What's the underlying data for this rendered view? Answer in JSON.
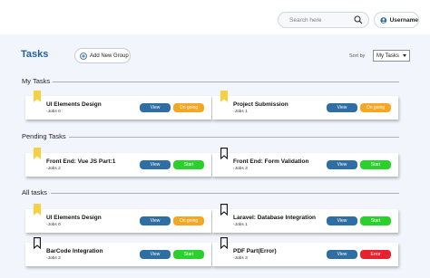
{
  "header": {
    "search_placeholder": "Search here",
    "username": "Username"
  },
  "toolbar": {
    "page_title": "Tasks",
    "add_group_label": "Add New Group",
    "sort_label": "Sort by",
    "sort_value": "My Tasks"
  },
  "colors": {
    "accent": "#1f5fa8",
    "view_button": "#2e6ea3",
    "ongoing": "#f5a623",
    "start": "#2bd12b",
    "error": "#e8212f",
    "bookmark_filled": "#f5d142"
  },
  "sections": [
    {
      "label": "My Tasks"
    },
    {
      "label": "Pending Tasks"
    },
    {
      "label": "All tasks"
    }
  ],
  "cards": [
    {
      "title": "UI Elements Design",
      "jobs": "-Jobs 0",
      "view": "View",
      "status": "On going",
      "bookmark": "filled"
    },
    {
      "title": "Project Submission",
      "jobs": "-Jobs 1",
      "view": "View",
      "status": "On going",
      "bookmark": "filled"
    },
    {
      "title": "Front End: Vue JS Part:1",
      "jobs": "-Jobs 2",
      "view": "View",
      "status": "Start",
      "bookmark": "filled"
    },
    {
      "title": "Front End: Form Validation",
      "jobs": "-Jobs 3",
      "view": "View",
      "status": "Start",
      "bookmark": "outline"
    },
    {
      "title": "UI Elements Design",
      "jobs": "-Jobs 0",
      "view": "View",
      "status": "On going",
      "bookmark": "filled"
    },
    {
      "title": "Laravel: Database Integration",
      "jobs": "-Jobs 1",
      "view": "View",
      "status": "Start",
      "bookmark": "outline"
    },
    {
      "title": "BarCode Integration",
      "jobs": "-Jobs 2",
      "view": "View",
      "status": "Start",
      "bookmark": "outline"
    },
    {
      "title": "PDF Part(Error)",
      "jobs": "-Jobs 3",
      "view": "View",
      "status": "Error",
      "bookmark": "outline"
    }
  ]
}
